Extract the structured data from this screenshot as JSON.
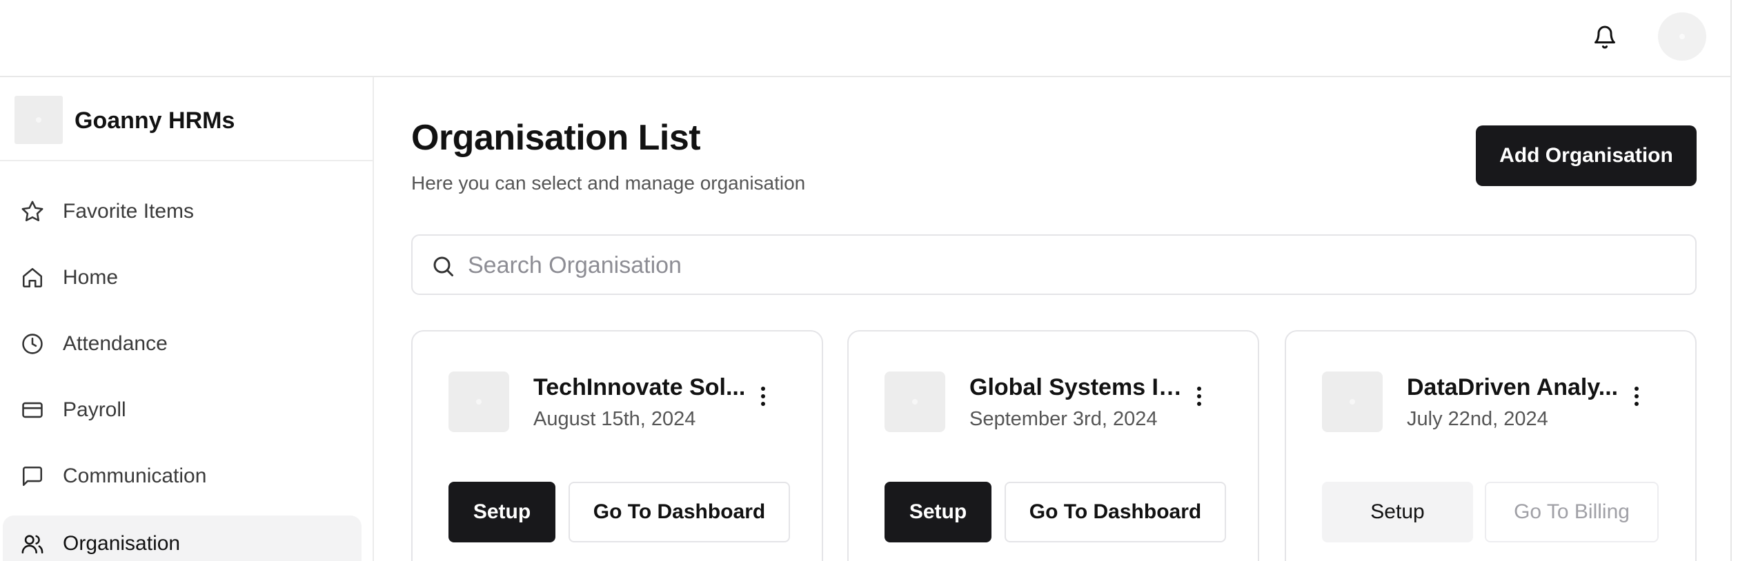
{
  "topbar": {
    "notification_icon": "bell-icon",
    "avatar": "user-avatar"
  },
  "brand": {
    "name": "Goanny HRMs"
  },
  "sidebar": {
    "items": [
      {
        "label": "Favorite Items",
        "icon": "star-icon",
        "active": false
      },
      {
        "label": "Home",
        "icon": "home-icon",
        "active": false
      },
      {
        "label": "Attendance",
        "icon": "clock-icon",
        "active": false
      },
      {
        "label": "Payroll",
        "icon": "credit-card-icon",
        "active": false
      },
      {
        "label": "Communication",
        "icon": "message-icon",
        "active": false
      },
      {
        "label": "Organisation",
        "icon": "users-icon",
        "active": true
      }
    ]
  },
  "main": {
    "title": "Organisation List",
    "subtitle": "Here you can select and manage organisation",
    "add_button": "Add Organisation",
    "search": {
      "placeholder": "Search Organisation",
      "value": ""
    },
    "cards": [
      {
        "name": "TechInnovate Sol...",
        "date": "August 15th, 2024",
        "primary_label": "Setup",
        "secondary_label": "Go To Dashboard",
        "state": "active"
      },
      {
        "name": "Global Systems In...",
        "date": "September 3rd, 2024",
        "primary_label": "Setup",
        "secondary_label": "Go To Dashboard",
        "state": "active"
      },
      {
        "name": "DataDriven Analy...",
        "date": "July 22nd, 2024",
        "primary_label": "Setup",
        "secondary_label": "Go To Billing",
        "state": "disabled"
      }
    ]
  },
  "colors": {
    "primary": "#18181b",
    "border": "#e4e4e7",
    "active_nav_bg": "#f3f3f4",
    "muted_text": "#8d8d94"
  }
}
